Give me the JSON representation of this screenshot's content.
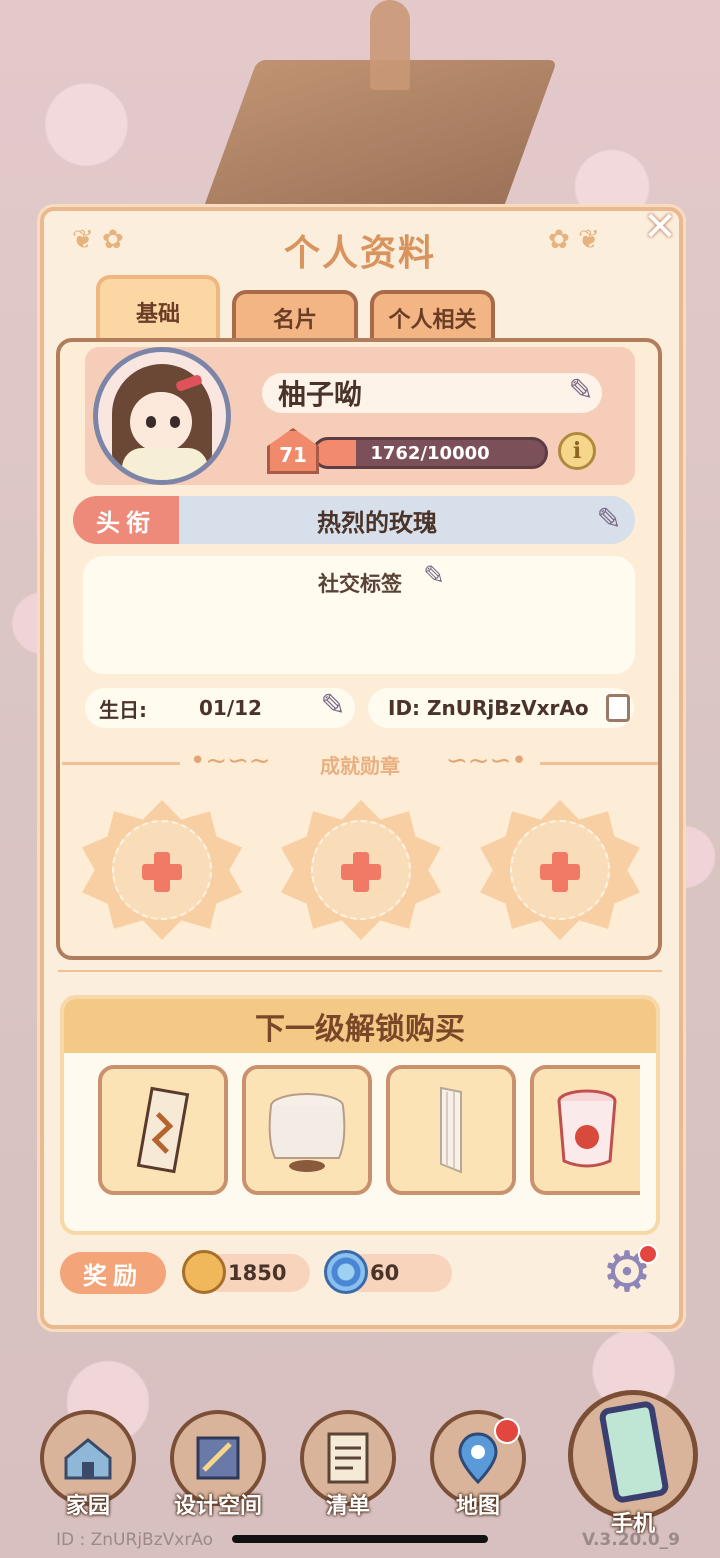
{
  "panel": {
    "title": "个人资料"
  },
  "tabs": [
    {
      "label": "基础",
      "active": true
    },
    {
      "label": "名片",
      "active": false
    },
    {
      "label": "个人相关",
      "active": false
    }
  ],
  "profile": {
    "name": "柚子呦",
    "level": "71",
    "xp_text": "1762/10000",
    "xp_fraction": 0.1762,
    "title_tag": "头衔",
    "title_value": "热烈的玫瑰",
    "social_label": "社交标签",
    "birthday_label": "生日:",
    "birthday_value": "01/12",
    "id_text": "ID: ZnURjBzVxrAo"
  },
  "medals": {
    "title": "成就勋章"
  },
  "unlock": {
    "title": "下一级解锁购买"
  },
  "rewards": {
    "label": "奖励",
    "coins": "1850",
    "gems": "60"
  },
  "nav": [
    {
      "label": "家园",
      "icon": "house-icon"
    },
    {
      "label": "设计空间",
      "icon": "blueprint-icon"
    },
    {
      "label": "清单",
      "icon": "list-icon"
    },
    {
      "label": "地图",
      "icon": "map-pin-icon"
    },
    {
      "label": "手机",
      "icon": "phone-icon"
    }
  ],
  "footer": {
    "id": "ID : ZnURjBzVxrAo",
    "version": "V.3.20.0_9"
  },
  "colors": {
    "accent": "#d9935c",
    "panel_bg": "#fbeedd",
    "xp_fill": "#f28a6d",
    "title_tag": "#ee8a7a"
  }
}
